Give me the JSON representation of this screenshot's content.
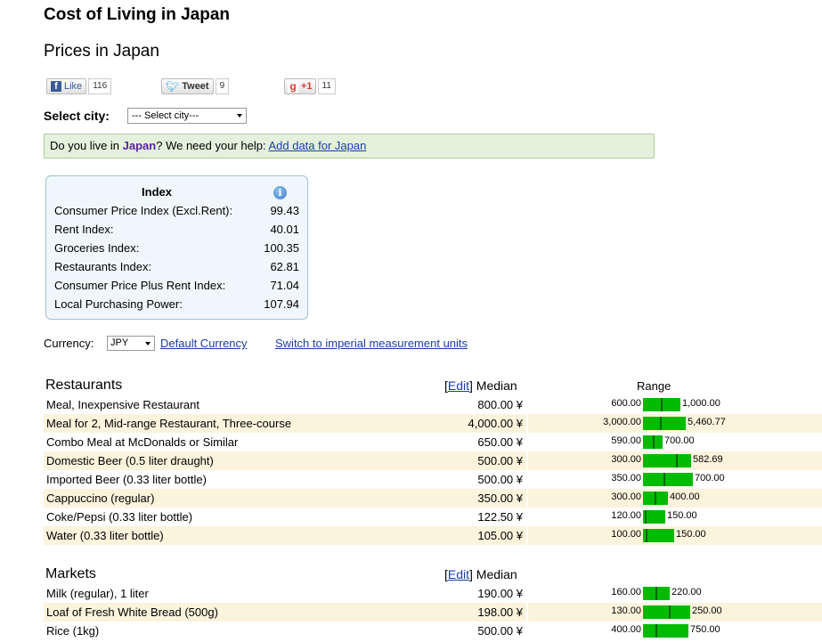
{
  "page": {
    "title": "Cost of Living in Japan",
    "subtitle": "Prices in Japan"
  },
  "social": {
    "like_label": "Like",
    "like_count": "116",
    "tweet_label": "Tweet",
    "tweet_count": "9",
    "gplus_label": "+1",
    "gplus_count": "11",
    "fb_icon_glyph": "f",
    "gplus_icon_glyph": "g"
  },
  "city": {
    "label": "Select city:",
    "selected": "--- Select city---"
  },
  "help": {
    "prefix": "Do you live in ",
    "country": "Japan",
    "middle": "? We need your help: ",
    "link": "Add data for Japan"
  },
  "index": {
    "title": "Index",
    "info_glyph": "i",
    "rows": [
      {
        "label": "Consumer Price Index (Excl.Rent):",
        "value": "99.43"
      },
      {
        "label": "Rent Index:",
        "value": "40.01"
      },
      {
        "label": "Groceries Index:",
        "value": "100.35"
      },
      {
        "label": "Restaurants Index:",
        "value": "62.81"
      },
      {
        "label": "Consumer Price Plus Rent Index:",
        "value": "71.04"
      },
      {
        "label": "Local Purchasing Power:",
        "value": "107.94"
      }
    ]
  },
  "currency": {
    "label": "Currency:",
    "selected": "JPY",
    "default_link": "Default Currency",
    "imperial_link": "Switch to imperial measurement units"
  },
  "table_header": {
    "edit": "Edit",
    "median": "Median",
    "range": "Range"
  },
  "sections": [
    {
      "title": "Restaurants",
      "rows": [
        {
          "label": "Meal, Inexpensive Restaurant",
          "median": "800.00 ¥",
          "min": "600.00",
          "max": "1,000.00",
          "min_v": 600,
          "max_v": 1000,
          "median_v": 800
        },
        {
          "label": "Meal for 2, Mid-range Restaurant, Three-course",
          "median": "4,000.00 ¥",
          "min": "3,000.00",
          "max": "5,460.77",
          "min_v": 3000,
          "max_v": 5460.77,
          "median_v": 4000
        },
        {
          "label": "Combo Meal at McDonalds or Similar",
          "median": "650.00 ¥",
          "min": "590.00",
          "max": "700.00",
          "min_v": 590,
          "max_v": 700,
          "median_v": 650
        },
        {
          "label": "Domestic Beer (0.5 liter draught)",
          "median": "500.00 ¥",
          "min": "300.00",
          "max": "582.69",
          "min_v": 300,
          "max_v": 582.69,
          "median_v": 500
        },
        {
          "label": "Imported Beer (0.33 liter bottle)",
          "median": "500.00 ¥",
          "min": "350.00",
          "max": "700.00",
          "min_v": 350,
          "max_v": 700,
          "median_v": 500
        },
        {
          "label": "Cappuccino (regular)",
          "median": "350.00 ¥",
          "min": "300.00",
          "max": "400.00",
          "min_v": 300,
          "max_v": 400,
          "median_v": 350
        },
        {
          "label": "Coke/Pepsi (0.33 liter bottle)",
          "median": "122.50 ¥",
          "min": "120.00",
          "max": "150.00",
          "min_v": 120,
          "max_v": 150,
          "median_v": 122.5
        },
        {
          "label": "Water (0.33 liter bottle)",
          "median": "105.00 ¥",
          "min": "100.00",
          "max": "150.00",
          "min_v": 100,
          "max_v": 150,
          "median_v": 105
        }
      ]
    },
    {
      "title": "Markets",
      "rows": [
        {
          "label": "Milk (regular), 1 liter",
          "median": "190.00 ¥",
          "min": "160.00",
          "max": "220.00",
          "min_v": 160,
          "max_v": 220,
          "median_v": 190
        },
        {
          "label": "Loaf of Fresh White Bread (500g)",
          "median": "198.00 ¥",
          "min": "130.00",
          "max": "250.00",
          "min_v": 130,
          "max_v": 250,
          "median_v": 198
        },
        {
          "label": "Rice (1kg)",
          "median": "500.00 ¥",
          "min": "400.00",
          "max": "750.00",
          "min_v": 400,
          "max_v": 750,
          "median_v": 500
        }
      ]
    }
  ]
}
